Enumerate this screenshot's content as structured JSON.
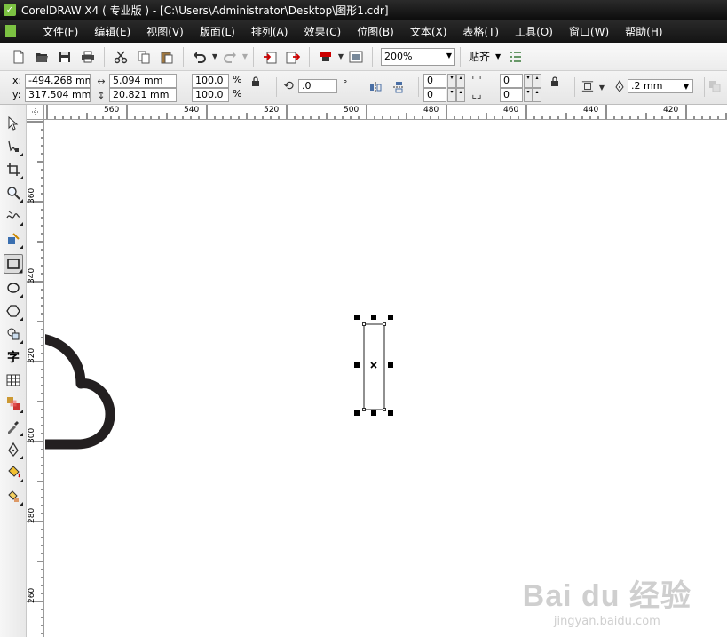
{
  "window": {
    "title": "CorelDRAW X4 ( 专业版 ) - [C:\\Users\\Administrator\\Desktop\\图形1.cdr]"
  },
  "menu": [
    {
      "label": "文件(F)"
    },
    {
      "label": "编辑(E)"
    },
    {
      "label": "视图(V)"
    },
    {
      "label": "版面(L)"
    },
    {
      "label": "排列(A)"
    },
    {
      "label": "效果(C)"
    },
    {
      "label": "位图(B)"
    },
    {
      "label": "文本(X)"
    },
    {
      "label": "表格(T)"
    },
    {
      "label": "工具(O)"
    },
    {
      "label": "窗口(W)"
    },
    {
      "label": "帮助(H)"
    }
  ],
  "toolbar": {
    "zoom_value": "200%",
    "snap_label": "贴齐"
  },
  "properties": {
    "x_label": "x:",
    "x_value": "-494.268 mm",
    "y_label": "y:",
    "y_value": "317.504 mm",
    "width_value": "5.094 mm",
    "height_value": "20.821 mm",
    "scale_x": "100.0",
    "scale_y": "100.0",
    "percent_sign": "%",
    "rotation_value": ".0",
    "degree_sign": "°",
    "corner_tl": "0",
    "corner_bl": "0",
    "corner_tr": "0",
    "corner_br": "0",
    "outline_width": ".2 mm"
  },
  "hruler_labels": [
    "560",
    "540",
    "520",
    "500",
    "480",
    "460",
    "440",
    "420"
  ],
  "vruler_labels": [
    "360",
    "340",
    "320",
    "300",
    "280",
    "260"
  ],
  "watermark": {
    "brand": "Bai du 经验",
    "url": "jingyan.baidu.com"
  },
  "colors": {
    "title_bg": "#1a1a1a",
    "shape_stroke": "#231f20",
    "handle": "#000000",
    "accent_green": "#7cc242"
  }
}
